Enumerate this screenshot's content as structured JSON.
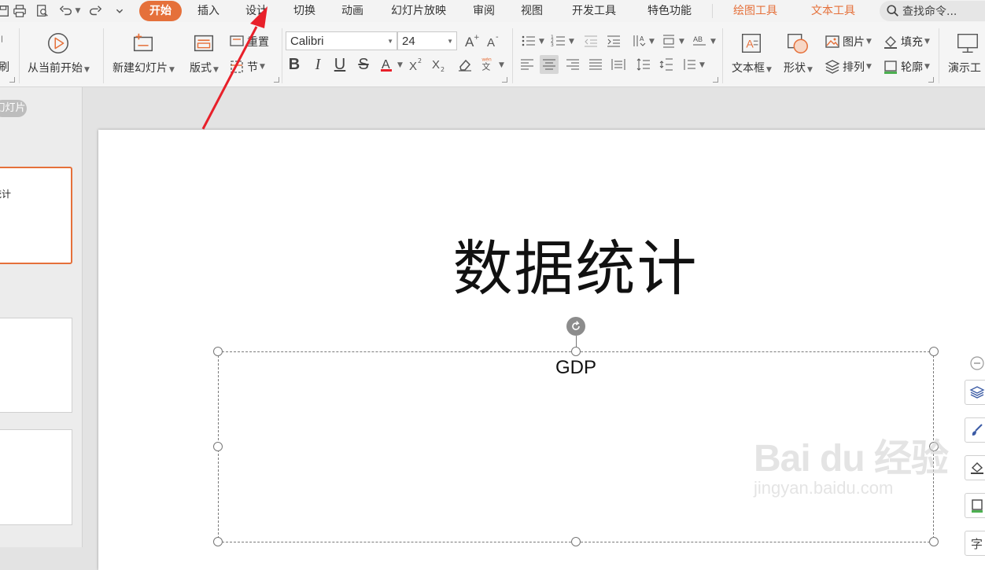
{
  "menu": {
    "tabs": [
      {
        "label": "开始",
        "active": true
      },
      {
        "label": "插入"
      },
      {
        "label": "设计"
      },
      {
        "label": "切换"
      },
      {
        "label": "动画"
      },
      {
        "label": "幻灯片放映"
      },
      {
        "label": "审阅"
      },
      {
        "label": "视图"
      },
      {
        "label": "开发工具"
      },
      {
        "label": "特色功能"
      }
    ],
    "context_tabs": [
      "绘图工具",
      "文本工具"
    ],
    "search": "查找命令..."
  },
  "ribbon": {
    "brush_label": "刷",
    "play_from_current": "从当前开始",
    "new_slide": "新建幻灯片",
    "layout": "版式",
    "reset": "重置",
    "section": "节",
    "font_name": "Calibri",
    "font_size": "24",
    "pinyin": "wén",
    "text_box": "文本框",
    "shape": "形状",
    "picture": "图片",
    "arrange": "排列",
    "fill": "填充",
    "outline": "轮廓",
    "present_tool": "演示工"
  },
  "panel": {
    "badge": "幻灯片",
    "thumb1_text": "数据统计"
  },
  "slide": {
    "title": "数据统计",
    "body_text": "GDP"
  },
  "watermark": {
    "main": "Bai du 经验",
    "sub": "jingyan.baidu.com"
  },
  "colors": {
    "accent": "#e5703a",
    "annotation_arrow": "#e8202a"
  }
}
